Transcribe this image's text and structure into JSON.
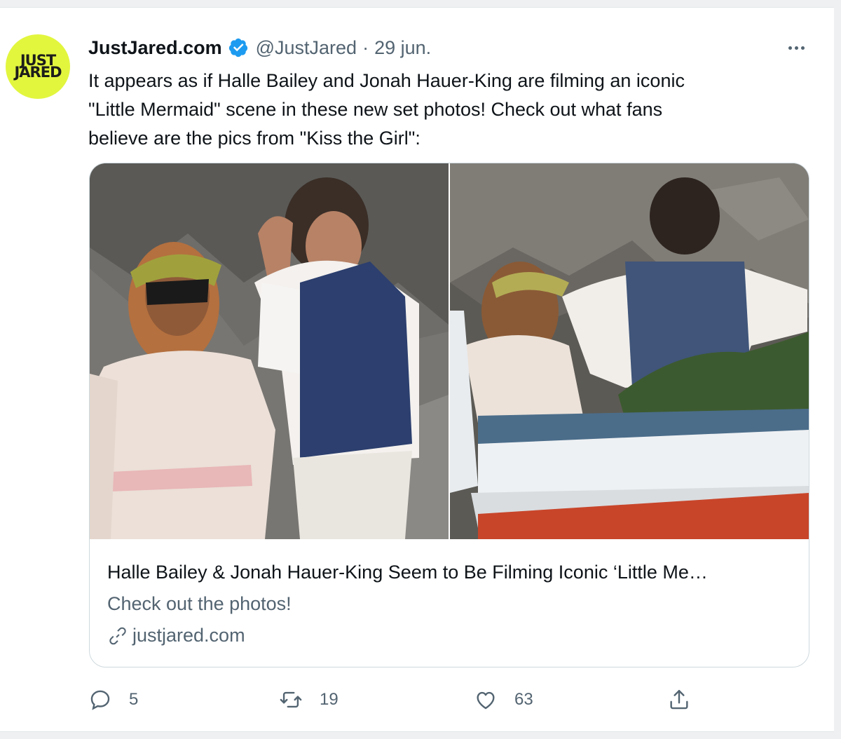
{
  "tweet": {
    "avatar": {
      "line1": "JUST",
      "line2": "JARED"
    },
    "author_name": "JustJared.com",
    "handle": "@JustJared",
    "separator": "·",
    "date": "29 jun.",
    "text_lines": [
      "It appears as if Halle Bailey and Jonah Hauer-King are filming an iconic",
      "\"Little Mermaid\" scene in these new set photos! Check out what fans",
      "believe are the pics from \"Kiss the Girl\":"
    ],
    "card": {
      "title": "Halle Bailey & Jonah Hauer-King Seem to Be Filming Iconic ‘Little Me…",
      "description": "Check out the photos!",
      "domain": "justjared.com"
    },
    "actions": {
      "replies": "5",
      "retweets": "19",
      "likes": "63"
    }
  },
  "icons": [
    "verified-badge-icon",
    "more-icon",
    "link-icon",
    "reply-icon",
    "retweet-icon",
    "like-icon",
    "share-icon"
  ],
  "colors": {
    "accent": "#1d9bf0",
    "avatar_bg": "#e2f63e",
    "muted": "#536471"
  }
}
